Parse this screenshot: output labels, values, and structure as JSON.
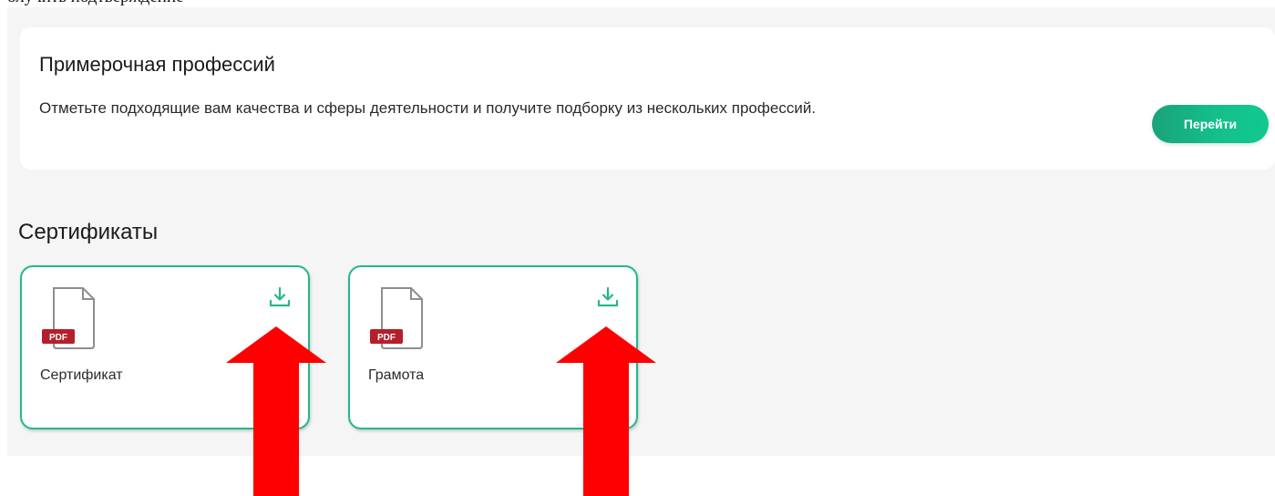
{
  "top_fragment": "олучить подтверждение",
  "promo": {
    "title": "Примерочная профессий",
    "description": "Отметьте подходящие вам качества и сферы деятельности и получите подборку из нескольких профессий.",
    "button_label": "Перейти"
  },
  "certificates": {
    "heading": "Сертификаты",
    "items": [
      {
        "name": "Сертификат",
        "file_badge": "PDF",
        "action_icon": "download-icon"
      },
      {
        "name": "Грамота",
        "file_badge": "PDF",
        "action_icon": "download-icon"
      }
    ]
  },
  "colors": {
    "accent_green": "#22b889",
    "button_green": "#14bf8a",
    "pdf_red": "#b51f2a",
    "panel_bg": "#f5f5f5",
    "annotation_arrow": "#ff0000"
  }
}
